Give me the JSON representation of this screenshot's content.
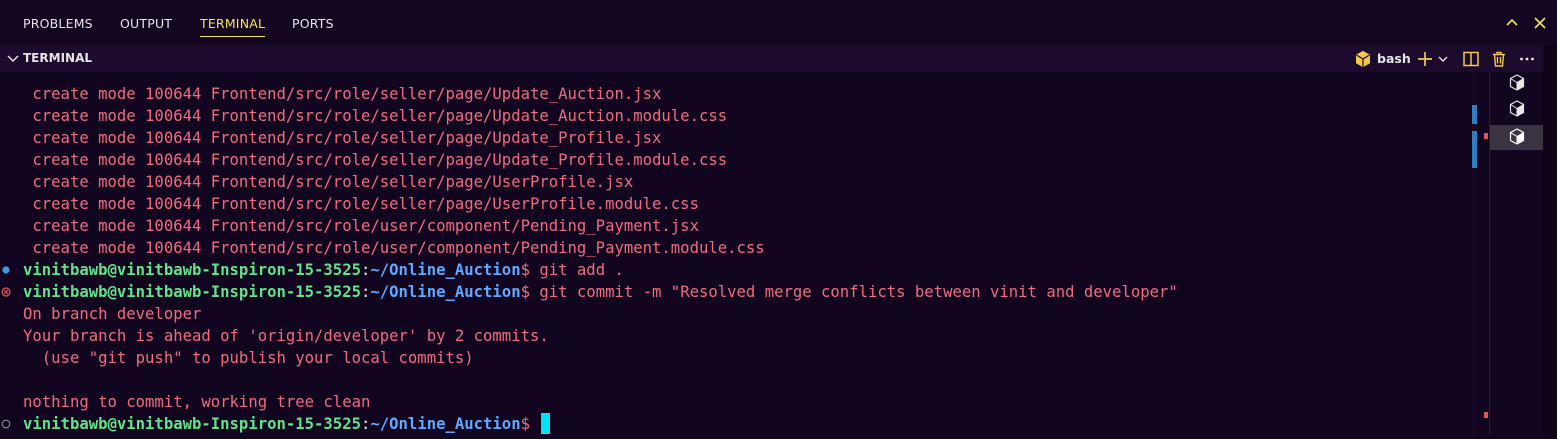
{
  "panel": {
    "tabs": [
      "PROBLEMS",
      "OUTPUT",
      "TERMINAL",
      "PORTS"
    ],
    "active_tab": "TERMINAL"
  },
  "terminal_header": {
    "title": "TERMINAL",
    "shell_label": "bash"
  },
  "terminal": {
    "lines": [
      " create mode 100644 Frontend/src/role/seller/page/Update_Auction.jsx",
      " create mode 100644 Frontend/src/role/seller/page/Update_Auction.module.css",
      " create mode 100644 Frontend/src/role/seller/page/Update_Profile.jsx",
      " create mode 100644 Frontend/src/role/seller/page/Update_Profile.module.css",
      " create mode 100644 Frontend/src/role/seller/page/UserProfile.jsx",
      " create mode 100644 Frontend/src/role/seller/page/UserProfile.module.css",
      " create mode 100644 Frontend/src/role/user/component/Pending_Payment.jsx",
      " create mode 100644 Frontend/src/role/user/component/Pending_Payment.module.css"
    ],
    "prompt_user": "vinitbawb@vinitbawb-Inspiron-15-3525",
    "prompt_path": "~/Online_Auction",
    "cmd1": "$ git add .",
    "cmd2": "$ git commit -m \"Resolved merge conflicts between vinit and developer\"",
    "out1": "On branch developer",
    "out2": "Your branch is ahead of 'origin/developer' by 2 commits.",
    "out3": "  (use \"git push\" to publish your local commits)",
    "out4": "nothing to commit, working tree clean",
    "cmd3": "$ "
  },
  "colors": {
    "background": "#12051f",
    "output_text": "#ef6b80",
    "prompt_user": "#5fe38b",
    "prompt_path": "#5fa7ff",
    "active_tab": "#f2e35a",
    "cursor": "#00e5f2"
  },
  "icons": [
    "chevron-down-icon",
    "terminal-icon",
    "plus-icon",
    "split-icon",
    "trash-icon",
    "more-icon",
    "maximize-chevron-icon",
    "close-icon",
    "success-dot-icon",
    "error-circle-icon",
    "pending-circle-icon"
  ]
}
